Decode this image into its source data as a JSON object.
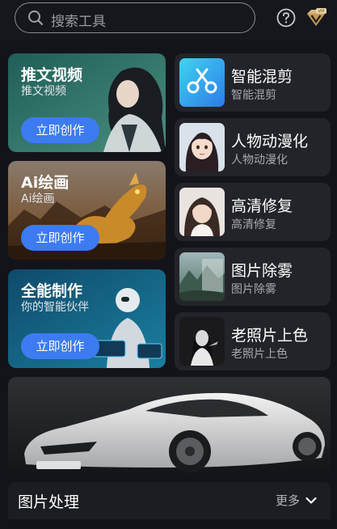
{
  "search": {
    "placeholder": "搜索工具"
  },
  "feature_cards": [
    {
      "title": "推文视频",
      "subtitle": "推文视频",
      "button": "立即创作"
    },
    {
      "title": "Ai绘画",
      "subtitle": "Ai绘画",
      "button": "立即创作"
    },
    {
      "title": "全能制作",
      "subtitle": "你的智能伙伴",
      "button": "立即创作"
    }
  ],
  "tools": [
    {
      "title": "智能混剪",
      "subtitle": "智能混剪",
      "icon": "scissors-icon"
    },
    {
      "title": "人物动漫化",
      "subtitle": "人物动漫化",
      "icon": "anime-portrait-thumbnail"
    },
    {
      "title": "高清修复",
      "subtitle": "高清修复",
      "icon": "portrait-thumbnail"
    },
    {
      "title": "图片除雾",
      "subtitle": "图片除雾",
      "icon": "landscape-thumbnail"
    },
    {
      "title": "老照片上色",
      "subtitle": "老照片上色",
      "icon": "old-photo-thumbnail"
    }
  ],
  "section": {
    "title": "图片处理",
    "more": "更多"
  },
  "colors": {
    "background": "#131419",
    "button": "#3d7bf2",
    "tool_card": "#23242a",
    "vip_badge": "#d8b47a"
  }
}
